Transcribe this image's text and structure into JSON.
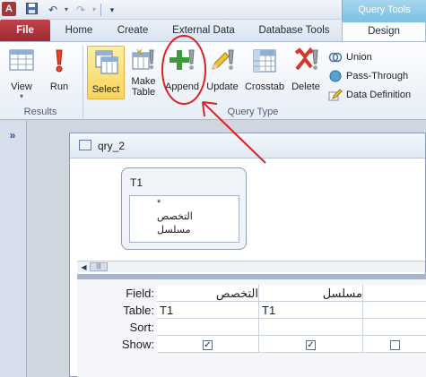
{
  "titlebar": {
    "app_icon": "A",
    "context_tab": "Query Tools"
  },
  "tabs": {
    "file": "File",
    "home": "Home",
    "create": "Create",
    "external_data": "External Data",
    "database_tools": "Database Tools",
    "design": "Design"
  },
  "ribbon": {
    "results": {
      "view": "View",
      "run": "Run",
      "label": "Results"
    },
    "query_type": {
      "select": "Select",
      "make_table_1": "Make",
      "make_table_2": "Table",
      "append": "Append",
      "update": "Update",
      "crosstab": "Crosstab",
      "delete": "Delete",
      "union": "Union",
      "pass_through": "Pass-Through",
      "data_definition": "Data Definition",
      "label": "Query Type"
    }
  },
  "nav": {
    "shutter": "»"
  },
  "query": {
    "name": "qry_2",
    "table": {
      "name": "T1",
      "fields": [
        "*",
        "التخصص",
        "مسلسل"
      ]
    },
    "grid": {
      "labels": {
        "field": "Field:",
        "table": "Table:",
        "sort": "Sort:",
        "show": "Show:"
      },
      "columns": [
        {
          "field": "التخصص",
          "table": "T1",
          "show": true
        },
        {
          "field": "مسلسل",
          "table": "T1",
          "show": true
        },
        {
          "field": "",
          "table": "",
          "show": false
        }
      ]
    }
  },
  "colors": {
    "file_tab": "#a4373a",
    "context_tab": "#7ec3e3",
    "selected_button": "#f8d559",
    "annotation": "#e02020"
  },
  "icons": {
    "view": "datasheet-view-icon",
    "run": "exclamation-icon",
    "select": "select-query-icon",
    "make_table": "make-table-icon",
    "append": "append-plus-icon",
    "update": "update-pencil-icon",
    "crosstab": "crosstab-grid-icon",
    "delete": "delete-x-icon",
    "union": "union-rings-icon",
    "pass_through": "globe-icon",
    "data_definition": "pencil-icon"
  }
}
